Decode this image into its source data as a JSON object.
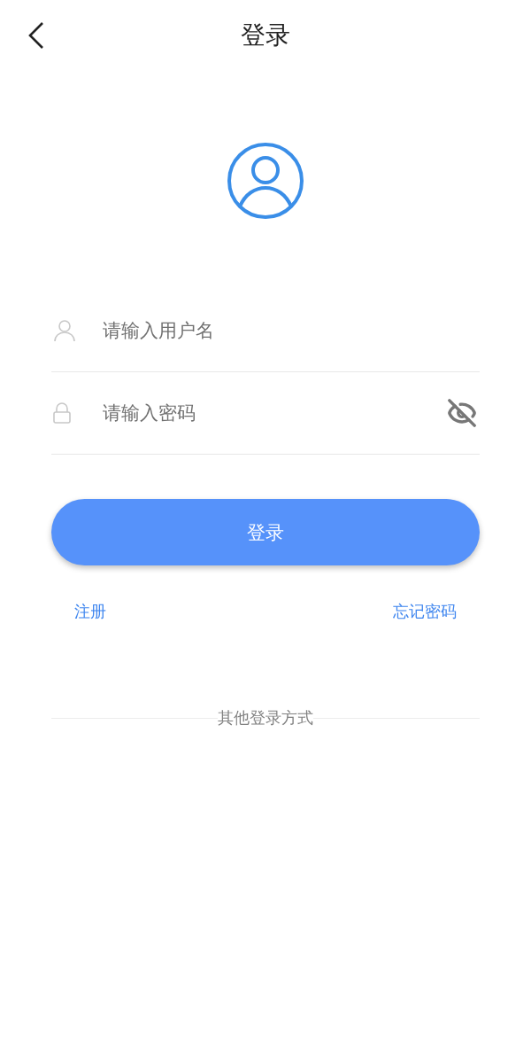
{
  "header": {
    "title": "登录"
  },
  "fields": [
    {
      "kind": "username",
      "placeholder": "请输入用户名"
    },
    {
      "kind": "password",
      "placeholder": "请输入密码",
      "password_visible": false
    }
  ],
  "login_button": "登录",
  "links": {
    "register": "注册",
    "forgot": "忘记密码"
  },
  "other_login": "其他登录方式"
}
